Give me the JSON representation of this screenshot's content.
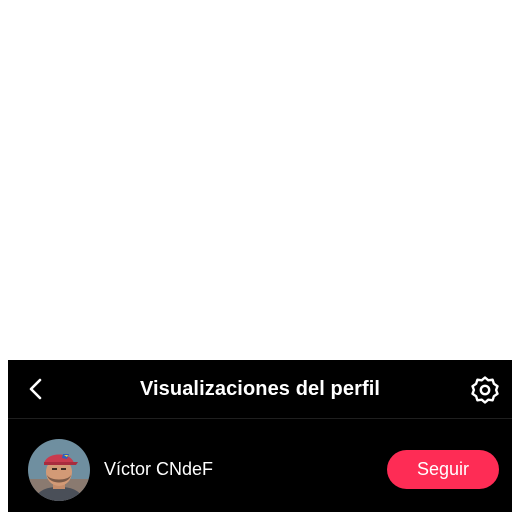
{
  "header": {
    "title": "Visualizaciones del perfil",
    "back_icon": "chevron-left-icon",
    "settings_icon": "gear-icon"
  },
  "profile": {
    "name": "Víctor CNdeF",
    "avatar_icon": "user-avatar",
    "follow_label": "Seguir"
  },
  "colors": {
    "panel_bg": "#000000",
    "accent": "#fe2c55",
    "text": "#ffffff"
  }
}
